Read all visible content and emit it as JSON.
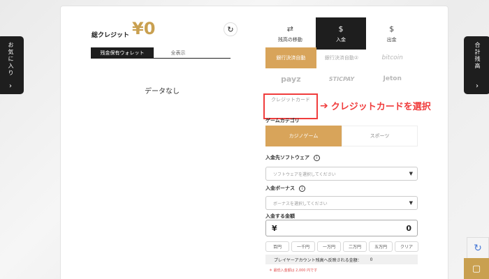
{
  "sidebar_left": {
    "label": "お気に入り",
    "chevron": "›"
  },
  "sidebar_right": {
    "label": "合計残高",
    "chevron": "›"
  },
  "wallet": {
    "credit_label": "総クレジット",
    "credit_value": "¥0",
    "refresh_icon": "↻",
    "tabs": [
      "残金保有ウォレット",
      "全表示"
    ],
    "empty_text": "データなし"
  },
  "nav": {
    "items": [
      {
        "label": "残高の移動",
        "icon": "⇄"
      },
      {
        "label": "入金",
        "icon": "$"
      },
      {
        "label": "出金",
        "icon": "$"
      }
    ]
  },
  "payment_methods": {
    "row1": [
      "銀行決済自動",
      "銀行決済自動②",
      "bitcoin"
    ],
    "row2": [
      "payz",
      "STICPAY",
      "Jeton"
    ],
    "row3": [
      "クレジットカード"
    ]
  },
  "annotation": {
    "arrow": "➔",
    "text": "クレジットカードを選択"
  },
  "game_category": {
    "label": "ゲームカテゴリ",
    "options": [
      "カジノゲーム",
      "スポーツ"
    ]
  },
  "software": {
    "label": "入金先ソフトウェア",
    "placeholder": "ソフトウェアを選択してください"
  },
  "bonus": {
    "label": "入金ボーナス",
    "placeholder": "ボーナスを選択してください"
  },
  "amount": {
    "label": "入金する金額",
    "currency": "¥",
    "value": "0"
  },
  "chips": [
    "百円",
    "一千円",
    "一万円",
    "二万円",
    "五万円",
    "クリア"
  ],
  "reflect": {
    "label": "プレイヤーアカウント残高へ反映される金額：",
    "value": "0"
  },
  "note": "＊ 最低入金額は 2,000 円です",
  "colors": {
    "accent": "#d8a45a",
    "gold": "#c9a050",
    "dark": "#1e1e1e",
    "alert": "#f03c3c"
  },
  "icons": {
    "recaptcha": "recaptcha-icon",
    "chat": "chat-icon"
  }
}
